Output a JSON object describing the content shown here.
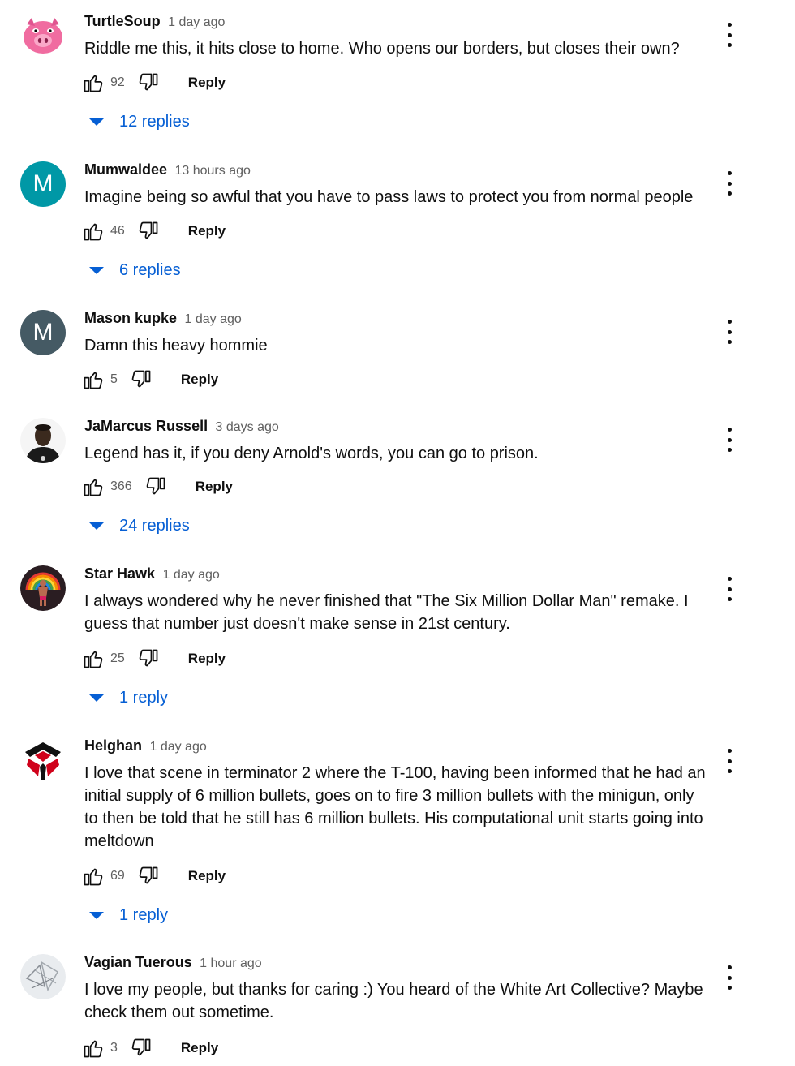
{
  "comments": [
    {
      "author": "TurtleSoup",
      "time": "1 day ago",
      "text": "Riddle me this, it hits close to home. Who opens our borders, but closes their own?",
      "likes": "92",
      "reply_label": "Reply",
      "replies": "12 replies",
      "avatar": {
        "type": "image",
        "icon": "pink-pig-avatar-icon",
        "color": "#f48fb1"
      }
    },
    {
      "author": "Mumwaldee",
      "time": "13 hours ago",
      "text": "Imagine being so awful that you have to pass laws to protect you from normal people",
      "likes": "46",
      "reply_label": "Reply",
      "replies": "6 replies",
      "avatar": {
        "type": "letter",
        "letter": "M",
        "color": "#0098a6"
      }
    },
    {
      "author": "Mason kupke",
      "time": "1 day ago",
      "text": "Damn this heavy hommie",
      "likes": "5",
      "reply_label": "Reply",
      "avatar": {
        "type": "letter",
        "letter": "M",
        "color": "#455a64"
      }
    },
    {
      "author": "JaMarcus Russell",
      "time": "3 days ago",
      "text": "Legend has it, if you deny Arnold's words, you can go to prison.",
      "likes": "366",
      "reply_label": "Reply",
      "replies": "24 replies",
      "avatar": {
        "type": "image",
        "icon": "person-photo-avatar-icon",
        "color": "#2b2b2b"
      }
    },
    {
      "author": "Star Hawk",
      "time": "1 day ago",
      "text": "I always wondered why he never finished that \"The Six Million Dollar Man\" remake.  I guess that number just doesn't make sense in 21st century.",
      "likes": "25",
      "reply_label": "Reply",
      "replies": "1 reply",
      "avatar": {
        "type": "image",
        "icon": "rainbow-figure-avatar-icon",
        "color": "#3a2a2a"
      }
    },
    {
      "author": "Helghan",
      "time": "1 day ago",
      "text": "I love that scene in terminator 2 where the T-100, having been informed that he had an initial supply of 6 million bullets, goes on to fire 3 million bullets with the minigun, only to then be told that he still has 6 million bullets. His computational unit starts going into meltdown",
      "likes": "69",
      "reply_label": "Reply",
      "replies": "1 reply",
      "avatar": {
        "type": "image",
        "icon": "helghast-logo-avatar-icon",
        "color": "#d0021b"
      }
    },
    {
      "author": "Vagian Tuerous",
      "time": "1 hour ago",
      "text": "I love my people, but thanks for caring :) You heard of the White Art Collective? Maybe check them out sometime.",
      "likes": "3",
      "reply_label": "Reply",
      "avatar": {
        "type": "image",
        "icon": "sketch-avatar-icon",
        "color": "#e9ecef"
      }
    }
  ],
  "icons": {
    "like": "thumbs-up-icon",
    "dislike": "thumbs-down-icon",
    "menu": "more-vert-icon",
    "expand": "caret-down-icon"
  },
  "colors": {
    "link": "#065fd4",
    "text": "#0f0f0f",
    "secondary": "#606060"
  }
}
